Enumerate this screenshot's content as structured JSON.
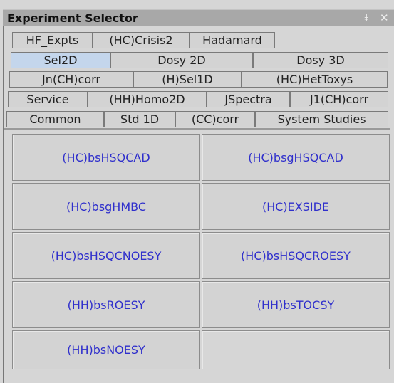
{
  "panel": {
    "title": "Experiment Selector",
    "pin_icon": "⯒",
    "close_icon": "✕"
  },
  "tabs": {
    "row1": [
      "HF_Expts",
      "(HC)Crisis2",
      "Hadamard"
    ],
    "row2": [
      "Sel2D",
      "Dosy 2D",
      "Dosy 3D"
    ],
    "row3": [
      "Jn(CH)corr",
      "(H)Sel1D",
      "(HC)HetToxys"
    ],
    "row4": [
      "Service",
      "(HH)Homo2D",
      "JSpectra",
      "J1(CH)corr"
    ],
    "row5": [
      "Common",
      "Std 1D",
      "(CC)corr",
      "System Studies"
    ],
    "selected": "Sel2D"
  },
  "experiments": [
    "(HC)bsHSQCAD",
    "(HC)bsgHSQCAD",
    "(HC)bsgHMBC",
    "(HC)EXSIDE",
    "(HC)bsHSQCNOESY",
    "(HC)bsHSQCROESY",
    "(HH)bsROESY",
    "(HH)bsTOCSY",
    "(HH)bsNOESY"
  ]
}
